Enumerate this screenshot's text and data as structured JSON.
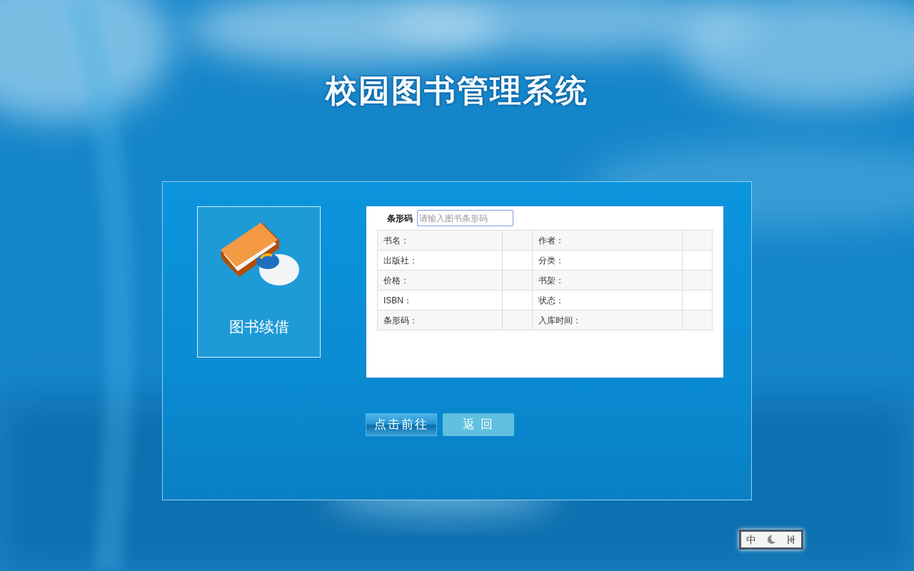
{
  "title": "校园图书管理系统",
  "tile": {
    "label": "图书续借"
  },
  "barcode_field": {
    "label": "条形码",
    "placeholder": "请输入图书条形码"
  },
  "info_rows": [
    {
      "left_label": "书名：",
      "right_label": "作者："
    },
    {
      "left_label": "出版社：",
      "right_label": "分类："
    },
    {
      "left_label": "价格：",
      "right_label": "书架："
    },
    {
      "left_label": "ISBN：",
      "right_label": "状态："
    },
    {
      "left_label": "条形码：",
      "right_label": "入库时间："
    }
  ],
  "buttons": [
    {
      "label": "点击前往",
      "kind": "primary"
    },
    {
      "label": "返 回",
      "kind": "secondary"
    }
  ],
  "ime_toolbar": {
    "mode": "中"
  }
}
